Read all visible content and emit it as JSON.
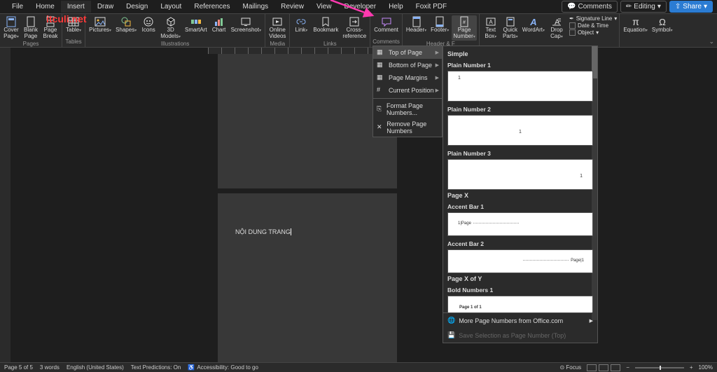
{
  "tabs": [
    "File",
    "Home",
    "Insert",
    "Draw",
    "Design",
    "Layout",
    "References",
    "Mailings",
    "Review",
    "View",
    "Developer",
    "Help",
    "Foxit PDF"
  ],
  "active_tab": "Insert",
  "tab_right": {
    "comments": "Comments",
    "editing": "Editing",
    "share": "Share"
  },
  "ribbon": {
    "pages": {
      "label": "Pages",
      "cover": "Cover\nPage",
      "blank": "Blank\nPage",
      "break": "Page\nBreak"
    },
    "tables": {
      "label": "Tables",
      "table": "Table"
    },
    "illustrations": {
      "label": "Illustrations",
      "pictures": "Pictures",
      "shapes": "Shapes",
      "icons": "Icons",
      "models": "3D\nModels",
      "smartart": "SmartArt",
      "chart": "Chart",
      "screenshot": "Screenshot"
    },
    "media": {
      "label": "Media",
      "videos": "Online\nVideos"
    },
    "links": {
      "label": "Links",
      "link": "Link",
      "bookmark": "Bookmark",
      "crossref": "Cross-\nreference"
    },
    "comments": {
      "label": "Comments",
      "comment": "Comment"
    },
    "headfoot": {
      "label": "Header & F",
      "header": "Header",
      "footer": "Footer",
      "pagenum": "Page\nNumber"
    },
    "text": {
      "textbox": "Text\nBox",
      "quick": "Quick\nParts",
      "wordart": "WordArt",
      "drop": "Drop\nCap",
      "sig": "Signature Line",
      "date": "Date & Time",
      "obj": "Object"
    },
    "symbols": {
      "equation": "Equation",
      "symbol": "Symbol"
    }
  },
  "menu": {
    "top": "Top of Page",
    "bottom": "Bottom of Page",
    "margins": "Page Margins",
    "current": "Current Position",
    "format": "Format Page Numbers...",
    "remove": "Remove Page Numbers"
  },
  "gallery": {
    "simple": "Simple",
    "plain1": "Plain Number 1",
    "plain2": "Plain Number 2",
    "plain3": "Plain Number 3",
    "pagex": "Page X",
    "accent1": "Accent Bar 1",
    "accent1_text": "1|Page",
    "accent2": "Accent Bar 2",
    "accent2_text": "Page|1",
    "pagexofy": "Page X of Y",
    "bold1": "Bold Numbers 1",
    "bold1_text": "Page 1 of 1",
    "more": "More Page Numbers from Office.com",
    "save": "Save Selection as Page Number (Top)"
  },
  "doc": {
    "content": "NỘI DUNG TRANG"
  },
  "watermark": "itculi.net",
  "status": {
    "page": "Page 5 of 5",
    "words": "3 words",
    "lang": "English (United States)",
    "predict": "Text Predictions: On",
    "access": "Accessibility: Good to go",
    "focus": "Focus",
    "zoom": "100%"
  }
}
